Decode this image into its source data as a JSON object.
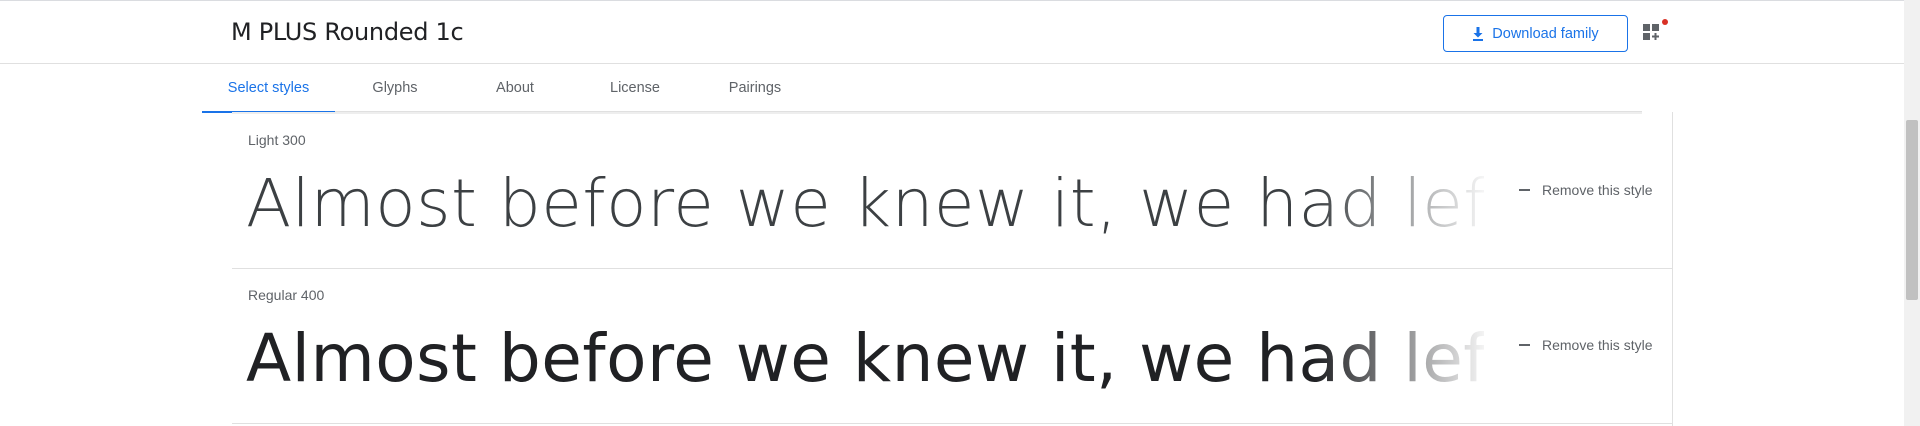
{
  "header": {
    "family_name": "M PLUS Rounded 1c",
    "download_label": "Download family",
    "apps_icon": "apps-grid-icon",
    "badge_color": "#d93025"
  },
  "tabs": [
    {
      "label": "Select styles",
      "active": true
    },
    {
      "label": "Glyphs",
      "active": false
    },
    {
      "label": "About",
      "active": false
    },
    {
      "label": "License",
      "active": false
    },
    {
      "label": "Pairings",
      "active": false
    }
  ],
  "styles": [
    {
      "name": "Light 300",
      "sample": "Almost before we knew it, we had left the ground",
      "action": "Remove this style"
    },
    {
      "name": "Regular 400",
      "sample": "Almost before we knew it, we had left the ground",
      "action": "Remove this style"
    }
  ],
  "colors": {
    "accent": "#1a73e8",
    "text": "#202124",
    "muted": "#5f6368"
  }
}
